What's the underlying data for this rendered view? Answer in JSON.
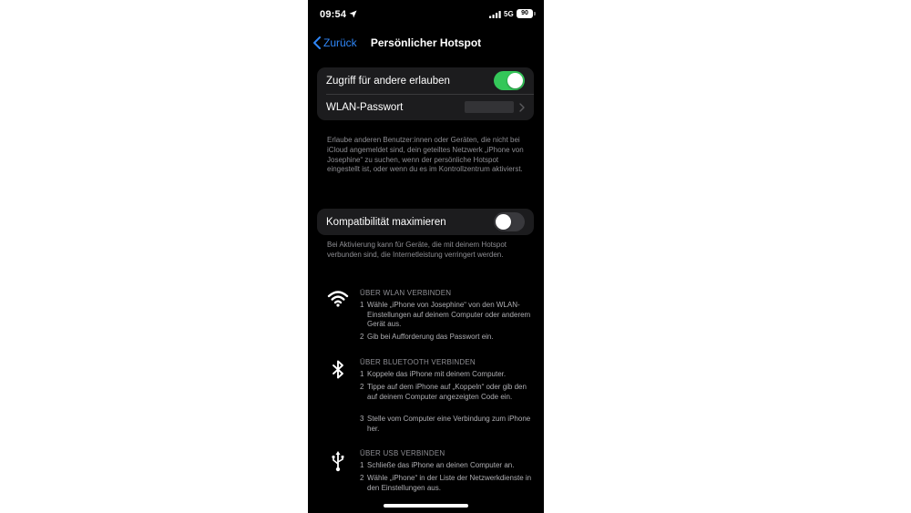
{
  "status_bar": {
    "time": "09:54",
    "network": "5G",
    "battery": "90"
  },
  "nav": {
    "back_label": "Zurück",
    "title": "Persönlicher Hotspot"
  },
  "access_group": {
    "allow_label": "Zugriff für andere erlauben",
    "allow_on": true,
    "wifi_password_label": "WLAN-Passwort"
  },
  "access_footnote": "Erlaube anderen Benutzer:innen oder Geräten, die nicht bei iCloud angemeldet sind, dein geteiltes Netzwerk „iPhone von Josephine“ zu suchen, wenn der persönliche Hotspot eingestellt ist, oder wenn du es im Kontrollzentrum aktivierst.",
  "compat_group": {
    "label": "Kompatibilität maximieren",
    "on": false
  },
  "compat_footnote": "Bei Aktivierung kann für Geräte, die mit deinem Hotspot verbunden sind, die Internetleistung verringert werden.",
  "instructions": {
    "wlan": {
      "title": "ÜBER WLAN VERBINDEN",
      "icon": "wifi-icon",
      "steps": [
        {
          "num": "1",
          "text": "Wähle „iPhone von Josephine“ von den WLAN-Einstellungen auf deinem Computer oder anderem Gerät aus."
        },
        {
          "num": "2",
          "text": "Gib bei Aufforderung das Passwort ein."
        }
      ]
    },
    "bluetooth": {
      "title": "ÜBER BLUETOOTH VERBINDEN",
      "icon": "bluetooth-icon",
      "steps": [
        {
          "num": "1",
          "text": "Koppele das iPhone mit deinem Computer."
        },
        {
          "num": "2",
          "text": "Tippe auf dem iPhone auf „Koppeln“ oder gib den auf deinem Computer angezeigten Code ein."
        },
        {
          "num": "3",
          "text": "Stelle vom Computer eine Verbindung zum iPhone her."
        }
      ]
    },
    "usb": {
      "title": "ÜBER USB VERBINDEN",
      "icon": "usb-icon",
      "steps": [
        {
          "num": "1",
          "text": "Schließe das iPhone an deinen Computer an."
        },
        {
          "num": "2",
          "text": "Wähle „iPhone“ in der Liste der Netzwerkdienste in den Einstellungen aus."
        }
      ]
    }
  },
  "colors": {
    "accent": "#2f86f7",
    "toggle_on": "#34c759",
    "cell_bg": "#1c1c1e",
    "footnote": "#8e8e93"
  }
}
